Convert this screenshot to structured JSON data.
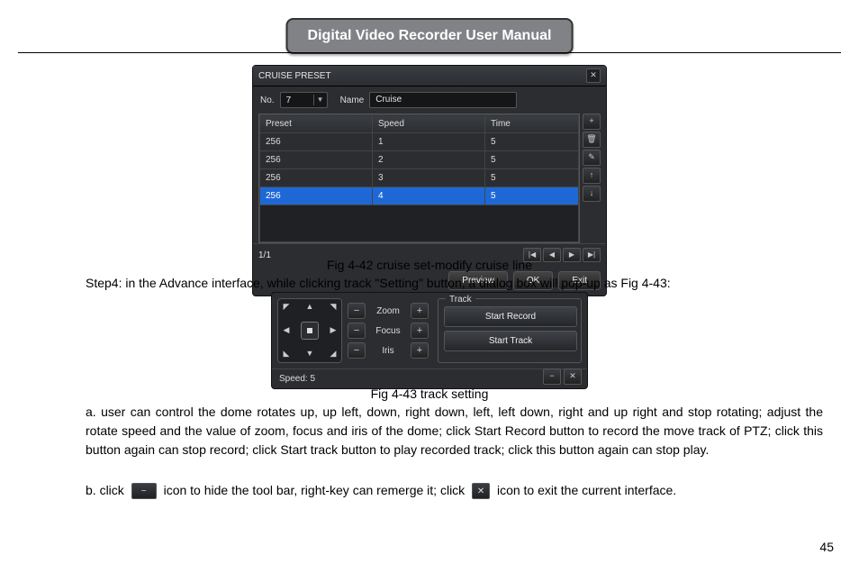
{
  "header": {
    "title": "Digital Video Recorder User Manual"
  },
  "page_number": "45",
  "dialog1": {
    "title": "CRUISE  PRESET",
    "no_label": "No.",
    "no_value": "7",
    "name_label": "Name",
    "name_value": "Cruise",
    "columns": {
      "preset": "Preset",
      "speed": "Speed",
      "time": "Time"
    },
    "rows": [
      {
        "preset": "256",
        "speed": "1",
        "time": "5",
        "selected": false
      },
      {
        "preset": "256",
        "speed": "2",
        "time": "5",
        "selected": false
      },
      {
        "preset": "256",
        "speed": "3",
        "time": "5",
        "selected": false
      },
      {
        "preset": "256",
        "speed": "4",
        "time": "5",
        "selected": true
      }
    ],
    "side_icons": {
      "add": "+",
      "delete": "🗑",
      "edit": "✎",
      "up": "↑",
      "down": "↓"
    },
    "pager": {
      "page": "1/1",
      "first": "|◀",
      "prev": "◀",
      "next": "▶",
      "last": "▶|"
    },
    "buttons": {
      "preview": "Preview",
      "ok": "OK",
      "exit": "Exit"
    }
  },
  "caption1": "Fig 4-42 cruise set-modify cruise line",
  "step4": "Step4: in the Advance interface, while clicking track \"Setting\" button, a dialog box will pop-up as Fig 4-43:",
  "dialog2": {
    "zoom_label": "Zoom",
    "focus_label": "Focus",
    "iris_label": "Iris",
    "minus": "−",
    "plus": "+",
    "track_legend": "Track",
    "start_record": "Start Record",
    "start_track": "Start Track",
    "minimize": "−",
    "close": "✕",
    "speed_label": "Speed:",
    "speed_value": "5"
  },
  "caption2": "Fig 4-43 track setting",
  "para_a": "a. user can control the dome rotates up, up left, down, right down, left, left down, right and up right and stop rotating; adjust the rotate speed and the value of zoom, focus and iris of the dome; click Start Record button to record the move track of PTZ; click this button again can stop record; click Start track button to play recorded track; click this button again can stop play.",
  "para_b": {
    "pre": "b. click ",
    "mid": " icon to hide the tool bar, right-key can remerge it; click ",
    "post": " icon to exit the current interface."
  }
}
